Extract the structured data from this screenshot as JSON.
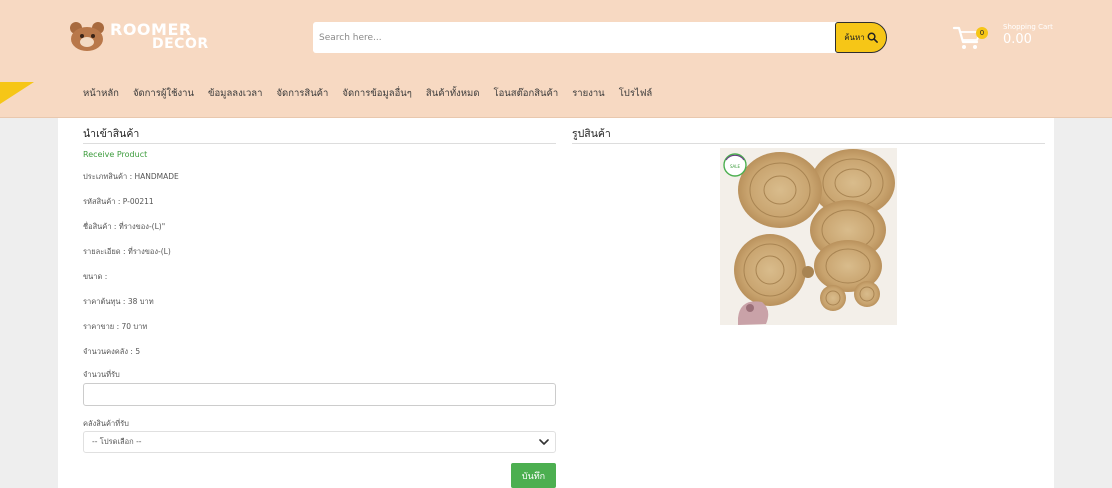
{
  "brand": {
    "name_line1": "ROOMER",
    "name_line2": "DECOR",
    "icon": "bear-logo-icon"
  },
  "search": {
    "placeholder": "Search here...",
    "button_label": "ค้นหา",
    "icon": "search-icon"
  },
  "cart": {
    "label": "Shopping Cart",
    "total": "0.00",
    "count": "0",
    "icon": "cart-icon"
  },
  "nav": {
    "items": [
      {
        "label": "หน้าหลัก"
      },
      {
        "label": "จัดการผู้ใช้งาน"
      },
      {
        "label": "ข้อมูลลงเวลา"
      },
      {
        "label": "จัดการสินค้า"
      },
      {
        "label": "จัดการข้อมูลอื่นๆ"
      },
      {
        "label": "สินค้าทั้งหมด"
      },
      {
        "label": "โอนสต๊อกสินค้า"
      },
      {
        "label": "รายงาน"
      },
      {
        "label": "โปรไฟล์"
      }
    ]
  },
  "form": {
    "title": "นำเข้าสินค้า",
    "subtitle": "Receive Product",
    "product_type": "ประเภทสินค้า : HANDMADE",
    "product_code": "รหัสสินค้า : P-00211",
    "product_name": "ชื่อสินค้า : ที่รางของ-(L)\"",
    "details": "รายละเอียด : ที่รางของ-(L)",
    "size": "ขนาด :",
    "cost_price": "ราคาต้นทุน : 38 บาท",
    "sell_price": "ราคาขาย : 70 บาท",
    "stock": "จำนวนคงคลัง : 5",
    "qty_label": "จำนวนที่รับ",
    "qty_value": "",
    "warehouse_label": "คลังสินค้าที่รับ",
    "warehouse_selected": "-- โปรดเลือก --",
    "save_label": "บันทึก"
  },
  "product_image": {
    "title": "รูปสินค้า",
    "badge_text": "SALE"
  },
  "colors": {
    "header_bg": "#f7d9c2",
    "accent_yellow": "#f6c617",
    "save_green": "#4caf50",
    "subtitle_green": "#3d9c3d"
  }
}
